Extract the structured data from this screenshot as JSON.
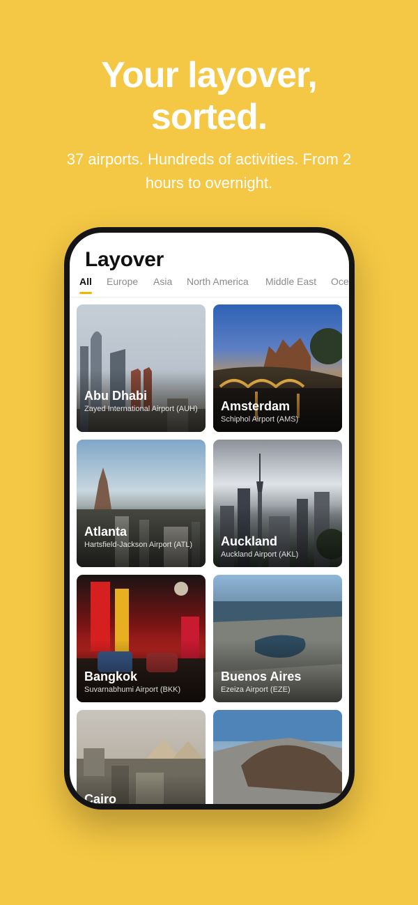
{
  "hero": {
    "headline_line1": "Your layover,",
    "headline_line2": "sorted.",
    "subheadline": "37 airports. Hundreds of activities. From 2 hours to overnight."
  },
  "app": {
    "title": "Layover",
    "tabs": [
      {
        "label": "All",
        "active": true
      },
      {
        "label": "Europe",
        "active": false
      },
      {
        "label": "Asia",
        "active": false
      },
      {
        "label": "North America",
        "active": false
      },
      {
        "label": "Middle East",
        "active": false
      },
      {
        "label": "Oce",
        "active": false
      }
    ],
    "accent_color": "#F4B400",
    "cities": [
      {
        "city": "Abu Dhabi",
        "airport": "Zayed International Airport (AUH)"
      },
      {
        "city": "Amsterdam",
        "airport": "Schiphol Airport (AMS)"
      },
      {
        "city": "Atlanta",
        "airport": "Hartsfield-Jackson Airport (ATL)"
      },
      {
        "city": "Auckland",
        "airport": "Auckland Airport (AKL)"
      },
      {
        "city": "Bangkok",
        "airport": "Suvarnabhumi Airport (BKK)"
      },
      {
        "city": "Buenos Aires",
        "airport": "Ezeiza Airport (EZE)"
      },
      {
        "city": "Cairo",
        "airport": ""
      },
      {
        "city": "",
        "airport": ""
      }
    ]
  },
  "colors": {
    "background": "#F4C744",
    "phone_frame": "#141414"
  }
}
